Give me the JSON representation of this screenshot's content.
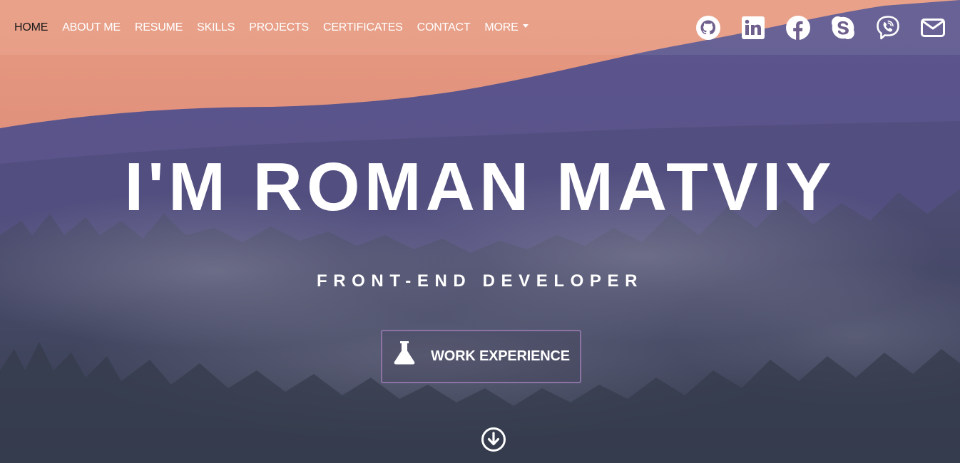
{
  "nav": {
    "items": [
      {
        "label": "HOME",
        "active": true
      },
      {
        "label": "ABOUT ME",
        "active": false
      },
      {
        "label": "RESUME",
        "active": false
      },
      {
        "label": "SKILLS",
        "active": false
      },
      {
        "label": "PROJECTS",
        "active": false
      },
      {
        "label": "CERTIFICATES",
        "active": false
      },
      {
        "label": "CONTACT",
        "active": false
      },
      {
        "label": "MORE",
        "active": false
      }
    ]
  },
  "social": {
    "icons": [
      "github-icon",
      "linkedin-icon",
      "facebook-icon",
      "skype-icon",
      "viber-icon",
      "email-icon"
    ]
  },
  "hero": {
    "title": "I'M ROMAN MATVIY",
    "subtitle": "FRONT-END DEVELOPER",
    "button_label": "WORK EXPERIENCE",
    "button_icon": "flask-icon",
    "scroll_icon": "arrow-circle-down-icon"
  },
  "colors": {
    "button_border": "#8c73a6",
    "active_nav": "#1a1a1a",
    "text": "#ffffff"
  }
}
